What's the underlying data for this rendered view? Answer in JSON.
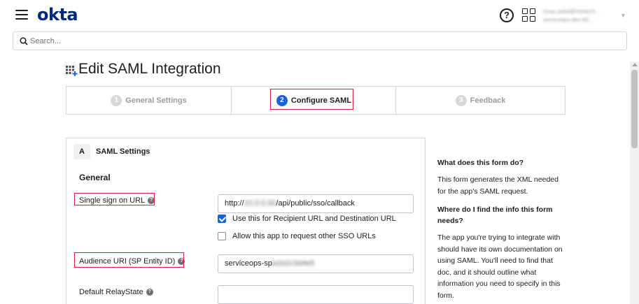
{
  "header": {
    "logo": "okta",
    "help_glyph": "?",
    "user_line1": "mrao.patel@mintech...",
    "user_line2": "serviceops-dev-62..."
  },
  "search": {
    "placeholder": "Search..."
  },
  "page": {
    "title": "Edit SAML Integration"
  },
  "wizard": {
    "steps": [
      {
        "num": "1",
        "label": "General Settings"
      },
      {
        "num": "2",
        "label": "Configure SAML"
      },
      {
        "num": "3",
        "label": "Feedback"
      }
    ]
  },
  "form": {
    "section_badge": "A",
    "section_title": "SAML Settings",
    "group_title": "General",
    "sso_url": {
      "label": "Single sign on URL",
      "value_prefix": "http://",
      "value_redacted": "10.0.0.00",
      "value_suffix": "/api/public/sso/callback"
    },
    "recipient_checkbox": "Use this for Recipient URL and Destination URL",
    "other_sso_checkbox": "Allow this app to request other SSO URLs",
    "audience_uri": {
      "label": "Audience URI (SP Entity ID)",
      "value_prefix": "serviceops-sp",
      "value_redacted": "a1b2c3d4e5"
    },
    "relay_state": {
      "label": "Default RelayState",
      "value": ""
    }
  },
  "help": {
    "q1": "What does this form do?",
    "a1": "This form generates the XML needed for the app's SAML request.",
    "q2": "Where do I find the info this form needs?",
    "a2": "The app you're trying to integrate with should have its own documentation on using SAML. You'll need to find that doc, and it should outline what information you need to specify in this form."
  },
  "colors": {
    "accent": "#1662dd",
    "highlight": "#e01e35",
    "brand": "#00297a"
  }
}
